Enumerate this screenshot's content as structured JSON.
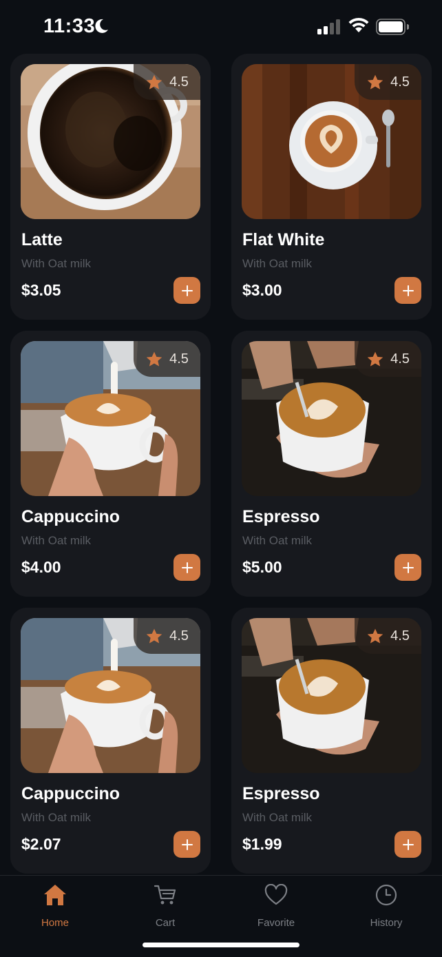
{
  "status_bar": {
    "time": "11:33"
  },
  "colors": {
    "accent": "#d17842",
    "card": "#17191e",
    "background": "#0c0f14",
    "muted": "#5a5d63"
  },
  "products": [
    {
      "name": "Latte",
      "subtitle": "With Oat milk",
      "price": "$3.05",
      "rating": "4.5",
      "photo": "black-coffee-top-view"
    },
    {
      "name": "Flat White",
      "subtitle": "With Oat milk",
      "price": "$3.00",
      "rating": "4.5",
      "photo": "latte-art-on-wood-table"
    },
    {
      "name": "Cappuccino",
      "subtitle": "With Oat milk",
      "price": "$4.00",
      "rating": "4.5",
      "photo": "milk-pour-into-cup"
    },
    {
      "name": "Espresso",
      "subtitle": "With Oat milk",
      "price": "$5.00",
      "rating": "4.5",
      "photo": "hands-holding-espresso"
    },
    {
      "name": "Cappuccino",
      "subtitle": "With Oat milk",
      "price": "$2.07",
      "rating": "4.5",
      "photo": "milk-pour-into-cup"
    },
    {
      "name": "Espresso",
      "subtitle": "With Oat milk",
      "price": "$1.99",
      "rating": "4.5",
      "photo": "hands-holding-espresso"
    }
  ],
  "nav": [
    {
      "label": "Home",
      "icon": "home-icon",
      "active": true
    },
    {
      "label": "Cart",
      "icon": "cart-icon",
      "active": false
    },
    {
      "label": "Favorite",
      "icon": "heart-icon",
      "active": false
    },
    {
      "label": "History",
      "icon": "clock-icon",
      "active": false
    }
  ]
}
